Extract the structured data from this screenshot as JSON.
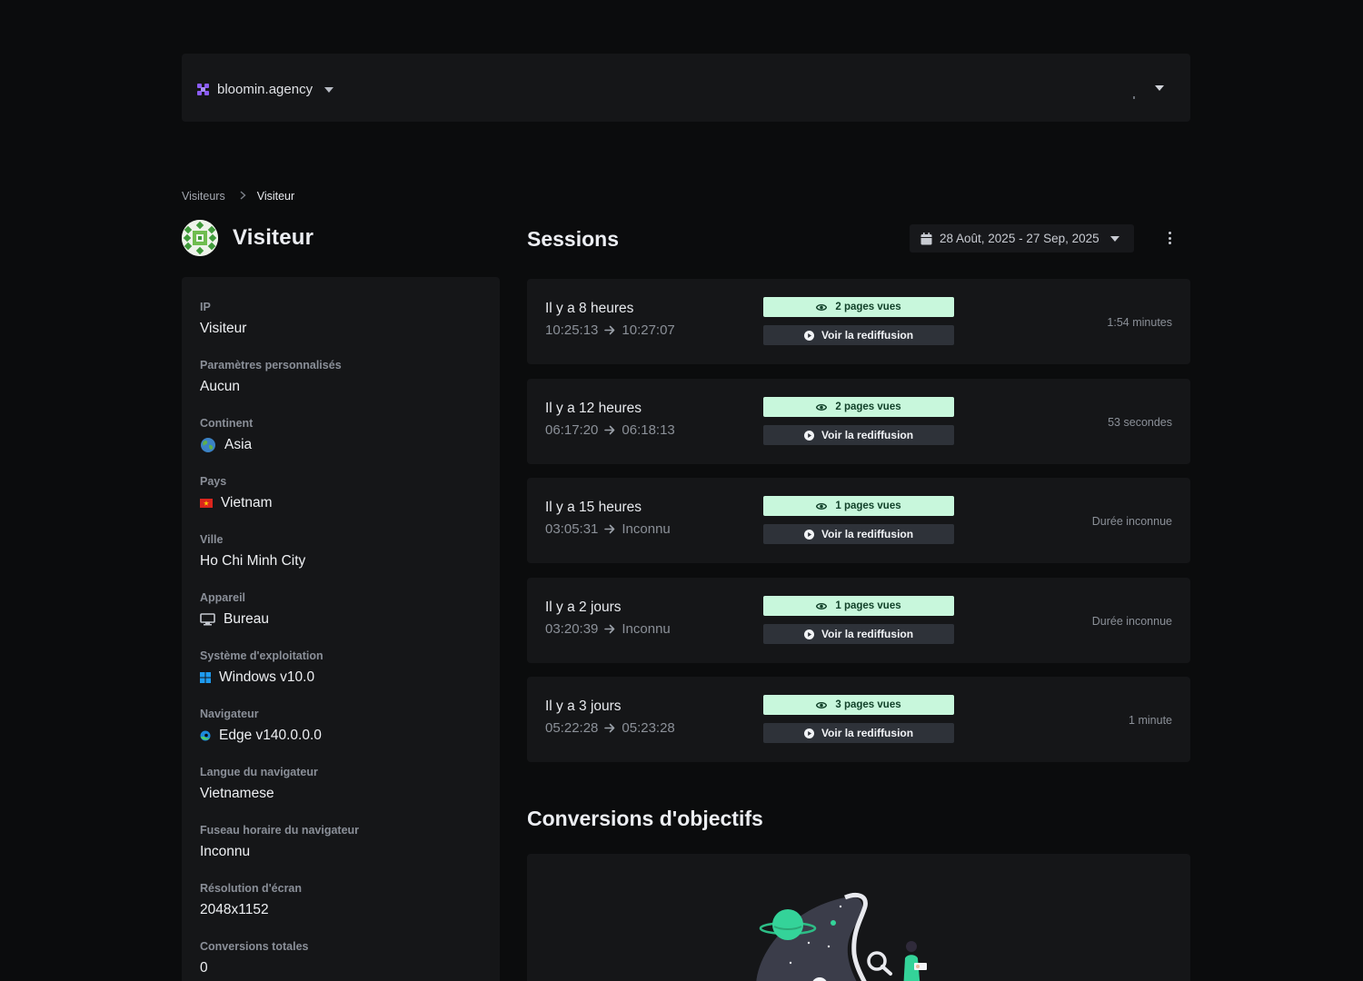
{
  "topbar": {
    "workspace_name": "bloomin.agency",
    "workspace_icon": "brand-logo-icon",
    "menu_icon": "chevron-down-icon"
  },
  "breadcrumb": {
    "parent": "Visiteurs",
    "current": "Visiteur"
  },
  "visitor": {
    "title": "Visiteur",
    "avatar_icon": "identicon-avatar"
  },
  "info": {
    "ip": {
      "label": "IP",
      "value": "Visiteur"
    },
    "custom_params": {
      "label": "Paramètres personnalisés",
      "value": "Aucun"
    },
    "continent": {
      "label": "Continent",
      "value": "Asia",
      "icon": "globe-icon"
    },
    "country": {
      "label": "Pays",
      "value": "Vietnam",
      "icon": "vietnam-flag-icon"
    },
    "city": {
      "label": "Ville",
      "value": "Ho Chi Minh City"
    },
    "device": {
      "label": "Appareil",
      "value": "Bureau",
      "icon": "desktop-icon"
    },
    "os": {
      "label": "Système d'exploitation",
      "value": "Windows v10.0",
      "icon": "windows-icon"
    },
    "browser": {
      "label": "Navigateur",
      "value": "Edge v140.0.0.0",
      "icon": "edge-icon"
    },
    "browser_language": {
      "label": "Langue du navigateur",
      "value": "Vietnamese"
    },
    "browser_timezone": {
      "label": "Fuseau horaire du navigateur",
      "value": "Inconnu"
    },
    "screen_resolution": {
      "label": "Résolution d'écran",
      "value": "2048x1152"
    },
    "total_conversions": {
      "label": "Conversions totales",
      "value": "0"
    }
  },
  "sessions": {
    "title": "Sessions",
    "date_range": "28 Août, 2025 - 27 Sep, 2025",
    "replay_label": "Voir la rediffusion",
    "items": [
      {
        "when": "Il y a 8 heures",
        "start": "10:25:13",
        "end": "10:27:07",
        "pages": "2 pages vues",
        "duration": "1:54 minutes"
      },
      {
        "when": "Il y a 12 heures",
        "start": "06:17:20",
        "end": "06:18:13",
        "pages": "2 pages vues",
        "duration": "53 secondes"
      },
      {
        "when": "Il y a 15 heures",
        "start": "03:05:31",
        "end": "Inconnu",
        "pages": "1 pages vues",
        "duration": "Durée inconnue"
      },
      {
        "when": "Il y a 2 jours",
        "start": "03:20:39",
        "end": "Inconnu",
        "pages": "1 pages vues",
        "duration": "Durée inconnue"
      },
      {
        "when": "Il y a 3 jours",
        "start": "05:22:28",
        "end": "05:23:28",
        "pages": "3 pages vues",
        "duration": "1 minute"
      }
    ]
  },
  "conversions": {
    "title": "Conversions d'objectifs"
  },
  "colors": {
    "background": "#0b0c0d",
    "panel": "#151618",
    "accent_purple": "#8b5cf6",
    "badge_green": "#c8f7dc",
    "illustration_green": "#34d399"
  }
}
